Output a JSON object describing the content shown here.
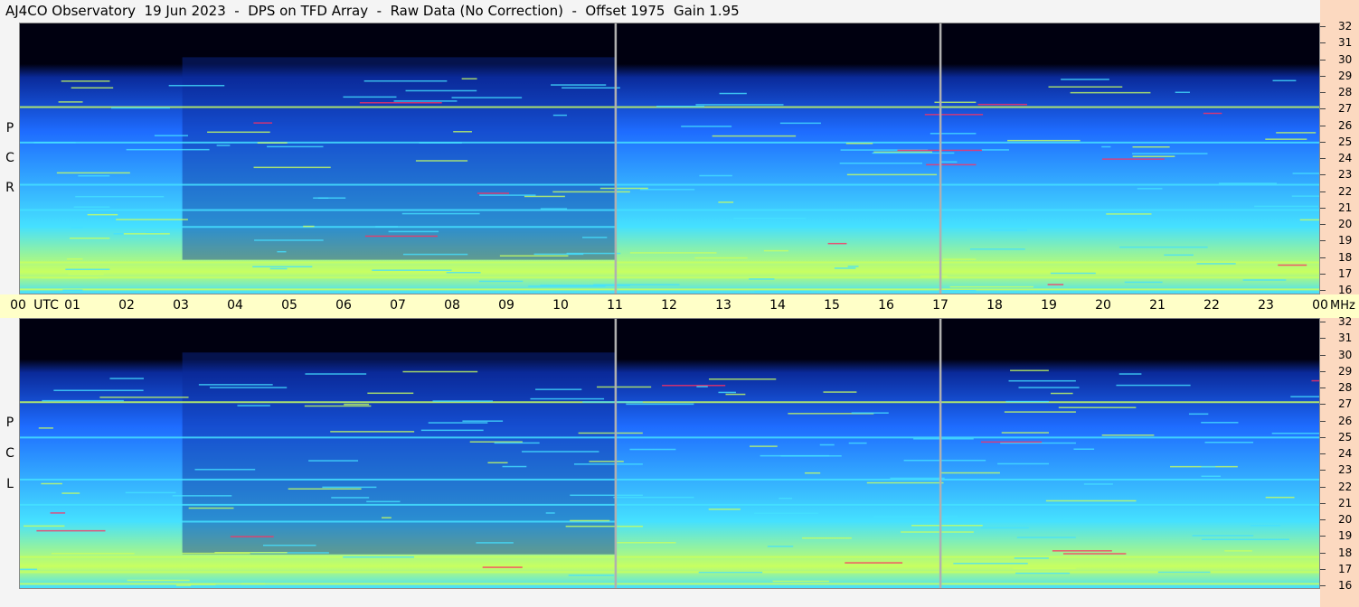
{
  "title": "AJ4CO Observatory  19 Jun 2023  -  DPS on TFD Array  -  Raw Data (No Correction)  -  Offset 1975  Gain 1.95",
  "colors": {
    "background": "#000010",
    "low": "#0a2a9a",
    "mid": "#1e6cff",
    "high": "#45e0ff",
    "peak": "#c8ff60",
    "hot": "#ff3060"
  },
  "chart_data": [
    {
      "type": "heatmap",
      "name": "R C P",
      "panel_label": [
        "R",
        "C",
        "P"
      ],
      "x_ticks": [
        "00",
        "01",
        "02",
        "03",
        "04",
        "05",
        "06",
        "07",
        "08",
        "09",
        "10",
        "11",
        "12",
        "13",
        "14",
        "15",
        "16",
        "17",
        "18",
        "19",
        "20",
        "21",
        "22",
        "23",
        "00"
      ],
      "x_unit": "UTC",
      "y_ticks": [
        "32",
        "31",
        "30",
        "29",
        "28",
        "27",
        "26",
        "25",
        "24",
        "23",
        "22",
        "21",
        "20",
        "19",
        "18",
        "17",
        "16"
      ],
      "y_unit": "MHz",
      "ylim": [
        16,
        32
      ],
      "xlim": [
        0,
        24
      ],
      "gaps_utc": [
        11,
        17
      ],
      "notable_bands_mhz": [
        27.1,
        25.0,
        22.5,
        21.0,
        20.0,
        17.9,
        17.0,
        16.3
      ]
    },
    {
      "type": "heatmap",
      "name": "L C P",
      "panel_label": [
        "L",
        "C",
        "P"
      ],
      "x_ticks": [
        "00",
        "01",
        "02",
        "03",
        "04",
        "05",
        "06",
        "07",
        "08",
        "09",
        "10",
        "11",
        "12",
        "13",
        "14",
        "15",
        "16",
        "17",
        "18",
        "19",
        "20",
        "21",
        "22",
        "23",
        "00"
      ],
      "x_unit": "UTC",
      "y_ticks": [
        "32",
        "31",
        "30",
        "29",
        "28",
        "27",
        "26",
        "25",
        "24",
        "23",
        "22",
        "21",
        "20",
        "19",
        "18",
        "17",
        "16"
      ],
      "y_unit": "MHz",
      "ylim": [
        16,
        32
      ],
      "xlim": [
        0,
        24
      ],
      "gaps_utc": [
        11,
        17
      ],
      "notable_bands_mhz": [
        27.1,
        25.0,
        22.5,
        21.0,
        20.0,
        17.9,
        17.0,
        16.3
      ]
    }
  ]
}
